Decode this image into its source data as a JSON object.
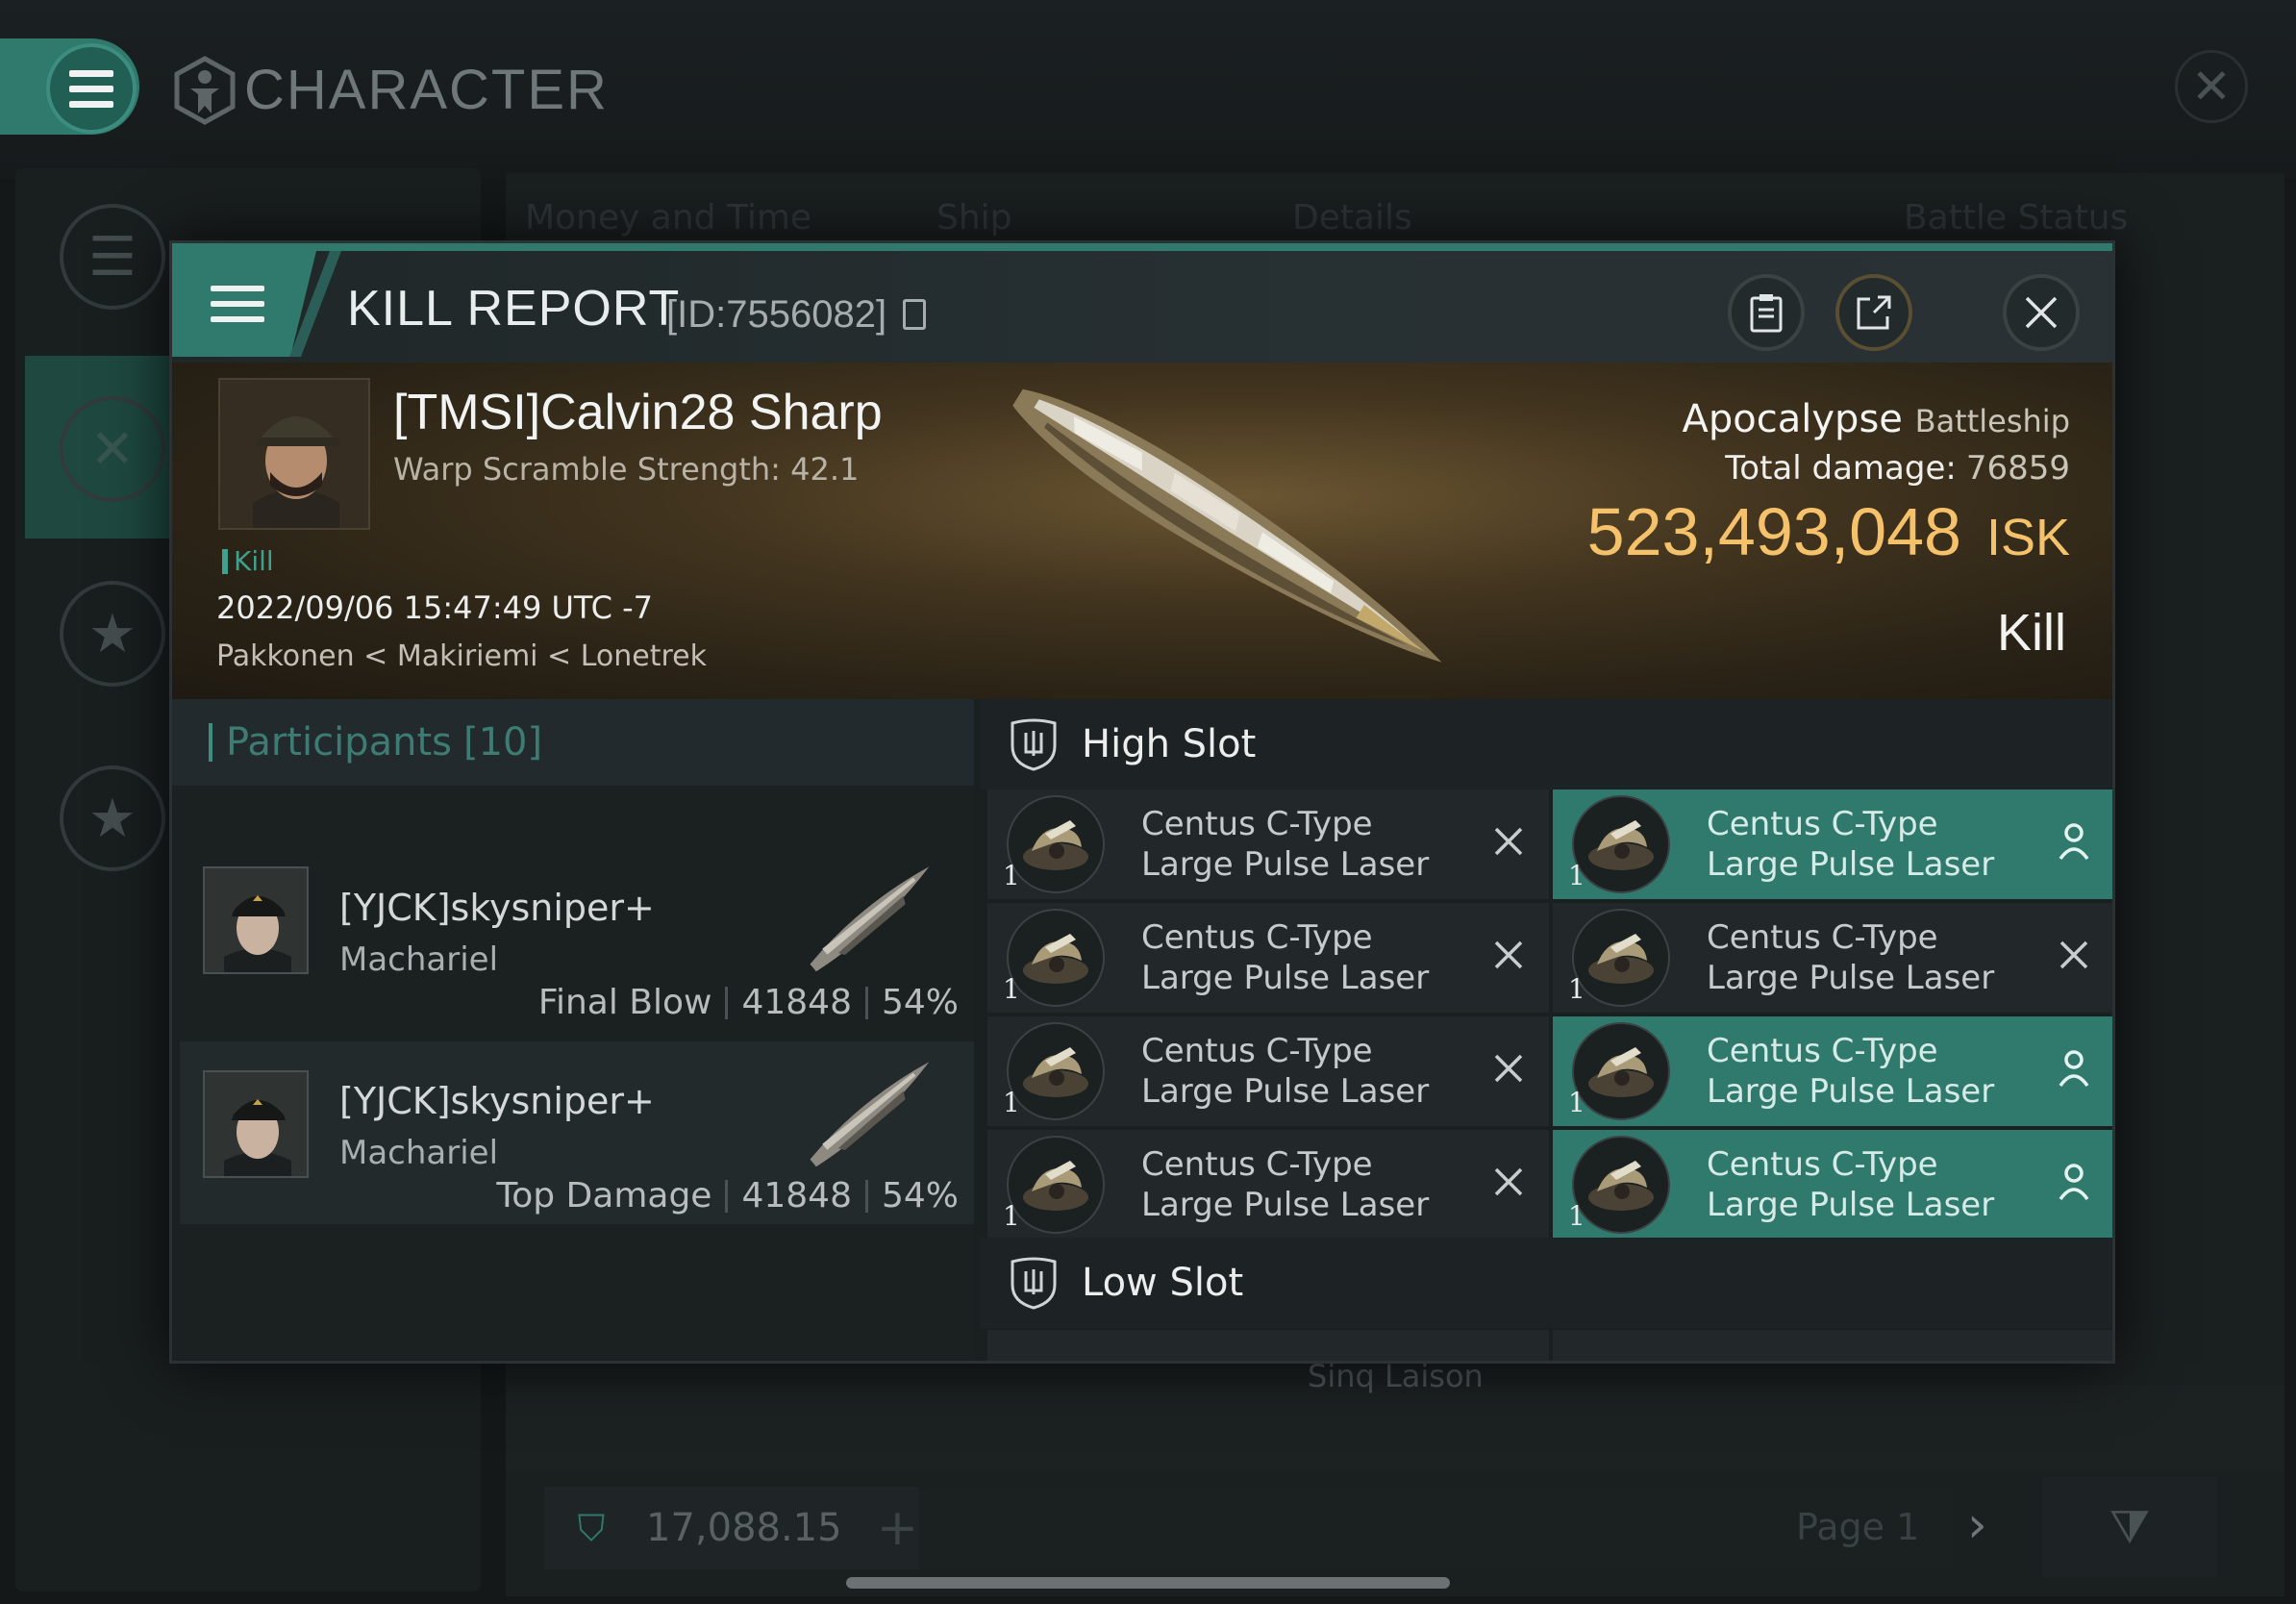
{
  "background": {
    "title": "CHARACTER",
    "table_headers": [
      "Money and Time",
      "Ship",
      "Details",
      "Battle Status"
    ],
    "wallet_value": "17,088.15",
    "page_label": "Page 1",
    "system_label": "Sinq Laison"
  },
  "kill_report": {
    "title": "KILL REPORT",
    "id_label": "[ID:7556082]",
    "victim": {
      "name": "[TMSI]Calvin28 Sharp",
      "warp_scramble": "Warp Scramble Strength: 42.1",
      "tag": "Kill",
      "datetime": "2022/09/06 15:47:49 UTC -7",
      "location": "Pakkonen < Makiriemi < Lonetrek"
    },
    "ship": {
      "name": "Apocalypse",
      "class": "Battleship"
    },
    "total_damage_label": "Total damage:",
    "total_damage_value": "76859",
    "isk_value": "523,493,048",
    "isk_unit": "ISK",
    "result": "Kill"
  },
  "participants": {
    "label": "Participants",
    "count": "[10]",
    "rows": [
      {
        "name": "[YJCK]skysniper+",
        "ship": "Machariel",
        "role": "Final Blow",
        "damage": "41848",
        "percent": "54%"
      },
      {
        "name": "[YJCK]skysniper+",
        "ship": "Machariel",
        "role": "Top Damage",
        "damage": "41848",
        "percent": "54%"
      }
    ]
  },
  "slots": {
    "high_label": "High Slot",
    "low_label": "Low Slot",
    "high_items": [
      {
        "name": "Centus C-Type Large Pulse Laser",
        "qty": "1",
        "state": "destroyed-x-icon",
        "highlight": false
      },
      {
        "name": "Centus C-Type Large Pulse Laser",
        "qty": "1",
        "state": "dropped-person-icon",
        "highlight": true
      },
      {
        "name": "Centus C-Type Large Pulse Laser",
        "qty": "1",
        "state": "destroyed-x-icon",
        "highlight": false
      },
      {
        "name": "Centus C-Type Large Pulse Laser",
        "qty": "1",
        "state": "destroyed-x-icon",
        "highlight": false
      },
      {
        "name": "Centus C-Type Large Pulse Laser",
        "qty": "1",
        "state": "destroyed-x-icon",
        "highlight": false
      },
      {
        "name": "Centus C-Type Large Pulse Laser",
        "qty": "1",
        "state": "dropped-person-icon",
        "highlight": true
      },
      {
        "name": "Centus C-Type Large Pulse Laser",
        "qty": "1",
        "state": "destroyed-x-icon",
        "highlight": false
      },
      {
        "name": "Centus C-Type Large Pulse Laser",
        "qty": "1",
        "state": "dropped-person-icon",
        "highlight": true
      }
    ]
  },
  "colors": {
    "accent": "#2f7a6d",
    "isk_gold": "#f5c26b",
    "panel": "#1a1f20"
  }
}
